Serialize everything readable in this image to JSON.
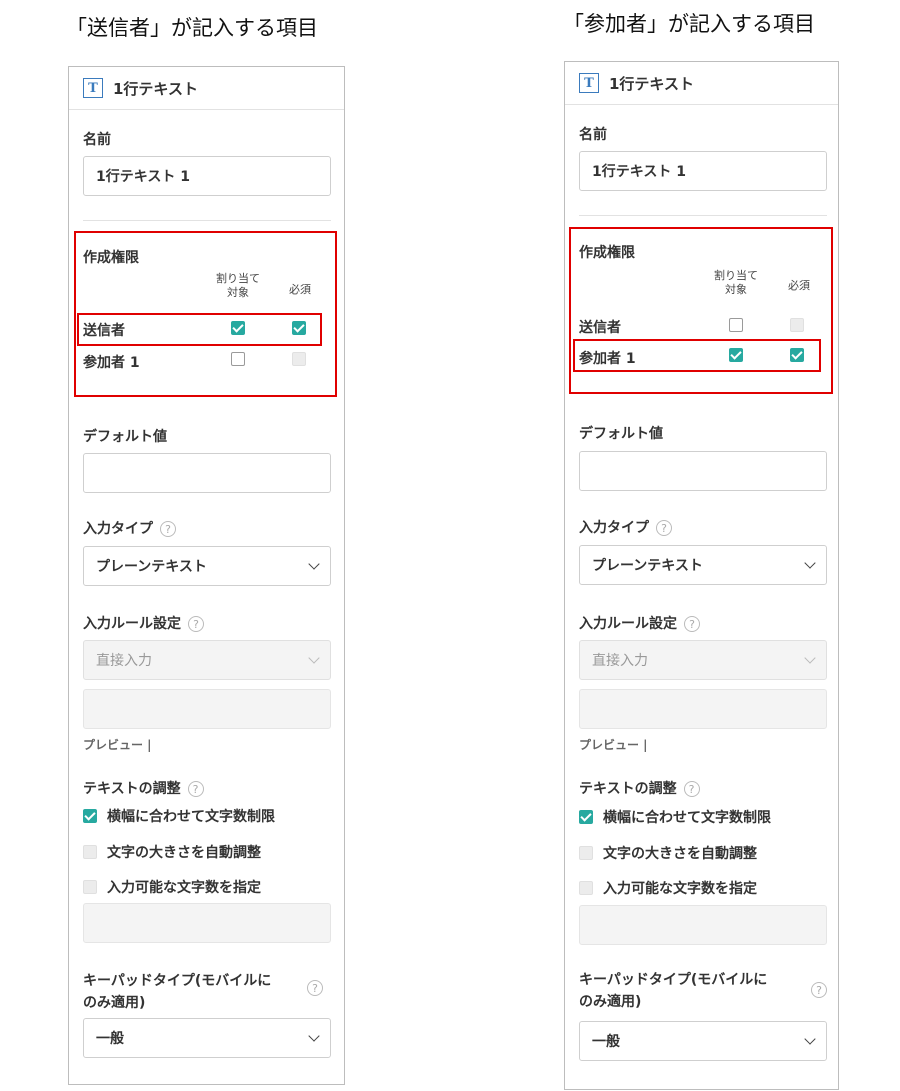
{
  "captions": {
    "left": "「送信者」が記入する項目",
    "right": "「参加者」が記入する項目"
  },
  "panel_common": {
    "title": "1行テキスト",
    "name_label": "名前",
    "name_value": "1行テキスト 1",
    "permission_label": "作成権限",
    "col_assign": "割り当て",
    "col_assign2": "対象",
    "col_required": "必須",
    "row_sender": "送信者",
    "row_participant": "参加者 1",
    "default_label": "デフォルト値",
    "default_value": "",
    "input_type_label": "入力タイプ",
    "input_type_value": "プレーンテキスト",
    "input_rule_label": "入力ルール設定",
    "input_rule_value": "直接入力",
    "preview_label": "プレビュー |",
    "text_adjust_label": "テキストの調整",
    "opt1": "横幅に合わせて文字数制限",
    "opt2": "文字の大きさを自動調整",
    "opt3": "入力可能な文字数を指定",
    "keypad_label_1": "キーパッドタイプ(モバイルに",
    "keypad_label_2": "のみ適用)",
    "keypad_value": "一般",
    "help_glyph": "?"
  },
  "left_panel": {
    "sender_assign": "checked",
    "sender_required": "checked",
    "participant_assign": "unchecked",
    "participant_required": "disabled",
    "opt1": "checked",
    "opt2": "disabled",
    "opt3": "disabled"
  },
  "right_panel": {
    "sender_assign": "unchecked",
    "sender_required": "disabled",
    "participant_assign": "checked",
    "participant_required": "checked",
    "opt1": "checked",
    "opt2": "disabled",
    "opt3": "disabled"
  },
  "icons": {
    "text-type-icon": "T",
    "help-icon": "?",
    "chevron-down-icon": "chevron"
  },
  "colors": {
    "checkbox_checked": "#27a9a0",
    "highlight_box": "#e00000",
    "type_icon": "#3b7bbd"
  }
}
